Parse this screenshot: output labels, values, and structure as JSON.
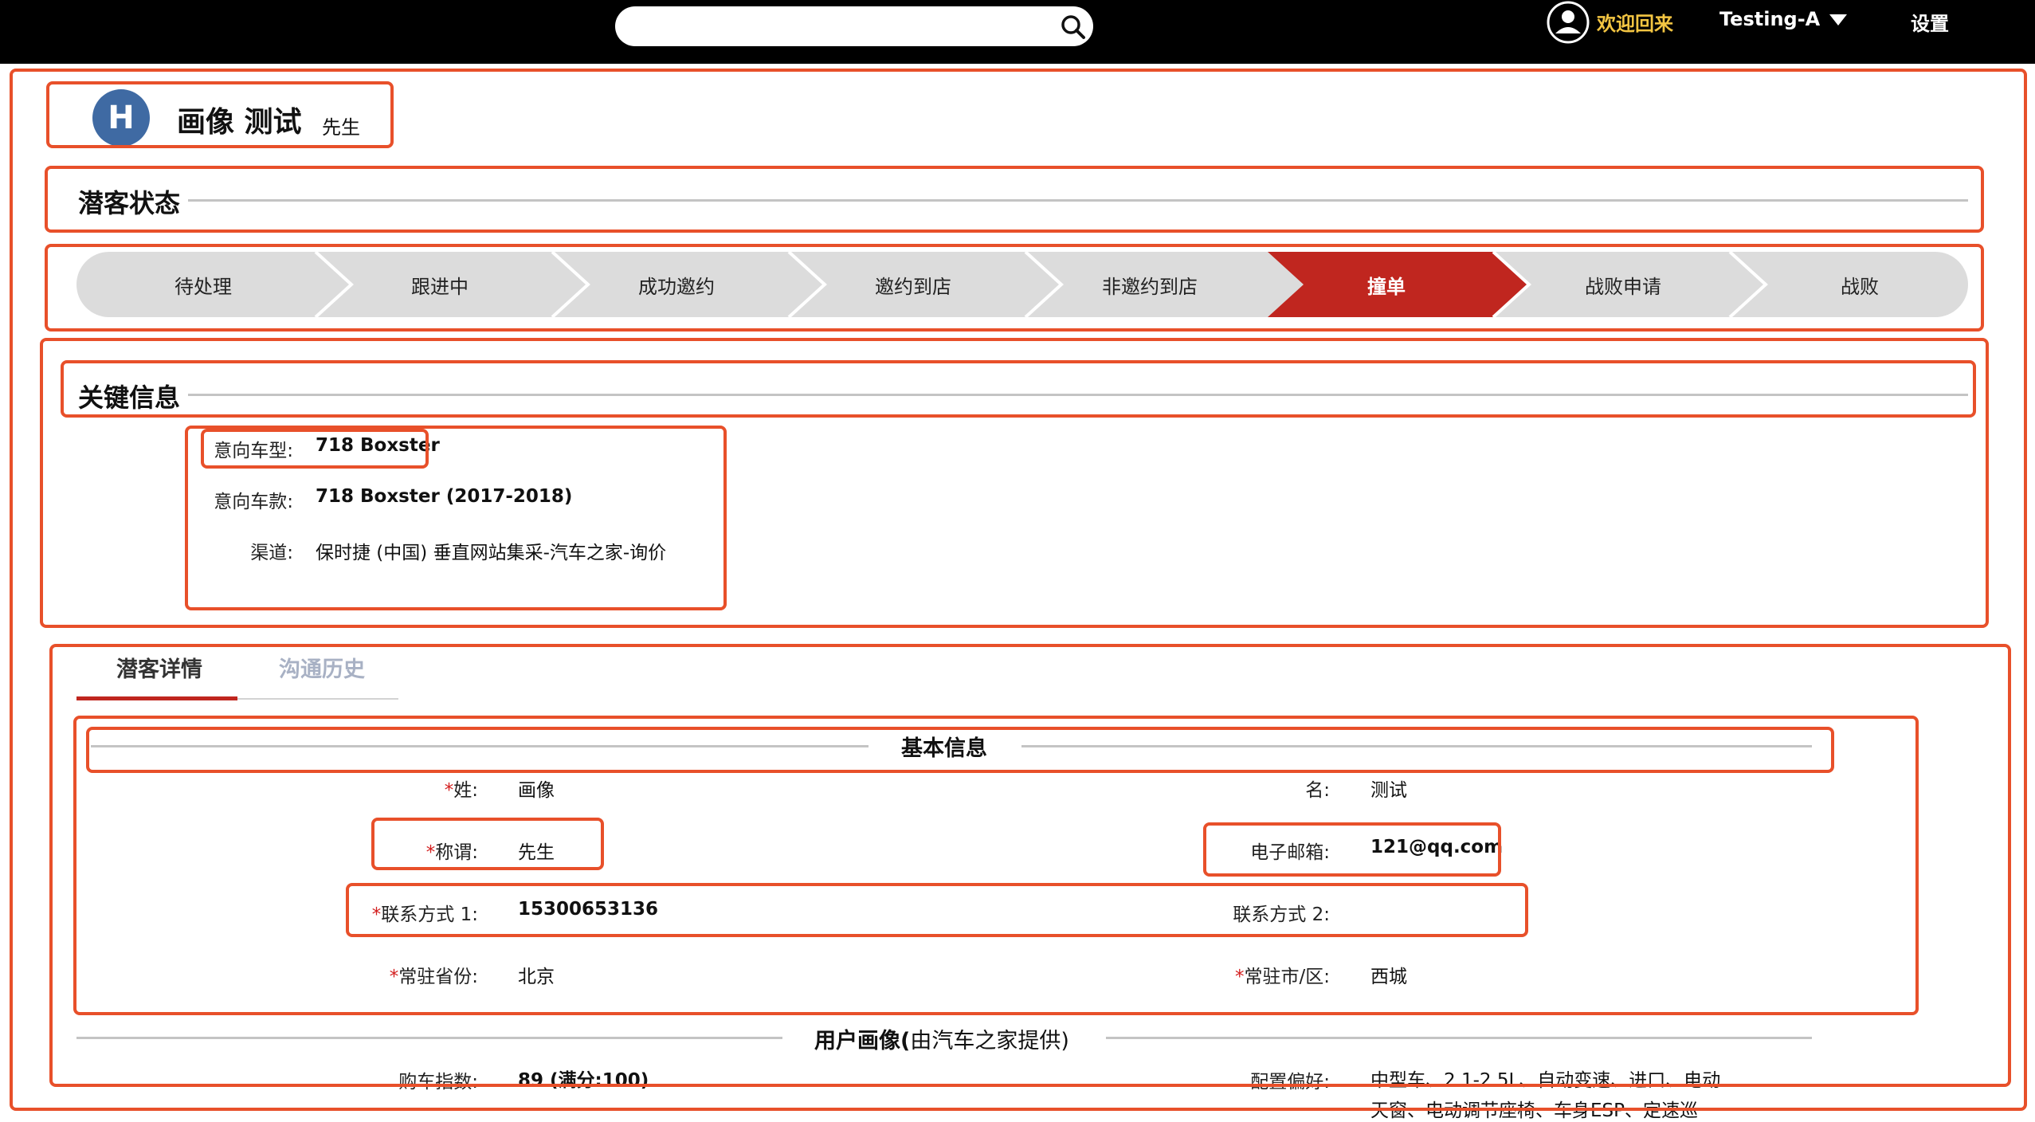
{
  "topbar": {
    "welcome": "欢迎回来",
    "user_name": "Testing-A",
    "settings": "设置",
    "search_placeholder": ""
  },
  "profile": {
    "avatar_letter": "H",
    "name": "画像 测试",
    "salutation": "先生"
  },
  "status_section": {
    "title": "潜客状态",
    "stages": [
      "待处理",
      "跟进中",
      "成功邀约",
      "邀约到店",
      "非邀约到店",
      "撞单",
      "战败申请",
      "战败"
    ],
    "active_stage": "撞单",
    "active_color": "#c0261f"
  },
  "key_info": {
    "title": "关键信息",
    "model_label": "意向车型:",
    "model_value": "718 Boxster",
    "version_label": "意向车款:",
    "version_value": "718 Boxster (2017-2018)",
    "channel_label": "渠道:",
    "channel_value": "保时捷 (中国) 垂直网站集采-汽车之家-询价"
  },
  "tabs": {
    "detail": "潜客详情",
    "history": "沟通历史"
  },
  "basic_info": {
    "title": "基本信息",
    "required_mark": "*",
    "surname_label": "姓:",
    "surname_value": "画像",
    "given_label": "名:",
    "given_value": "测试",
    "salutation_label": "称谓:",
    "salutation_value": "先生",
    "email_label": "电子邮箱:",
    "email_value": "121@qq.com",
    "contact1_label": "联系方式 1:",
    "contact1_value": "15300653136",
    "contact2_label": "联系方式 2:",
    "contact2_value": "",
    "province_label": "常驻省份:",
    "province_value": "北京",
    "city_label": "常驻市/区:",
    "city_value": "西城"
  },
  "user_portrait": {
    "title_main": "用户画像(",
    "title_sub": "由汽车之家提供)",
    "purchase_label": "购车指数:",
    "purchase_value": "89 (满分:100)",
    "pref_label": "配置偏好:",
    "pref_line1": "中型车、2.1-2.5L、自动变速、进口、电动",
    "pref_line2": "天窗、电动调节座椅、车身ESP、定速巡"
  },
  "colors": {
    "annotation": "#e8502a",
    "accent_red": "#c0261f",
    "welcome_yellow": "#f3c542",
    "avatar_blue": "#3f6aa3"
  }
}
